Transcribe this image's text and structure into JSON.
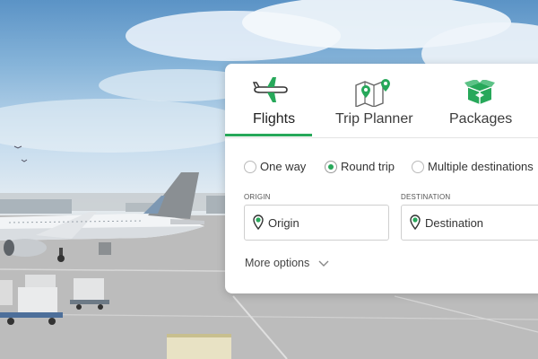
{
  "tabs": [
    {
      "label": "Flights",
      "icon": "airplane-icon",
      "active": true
    },
    {
      "label": "Trip Planner",
      "icon": "map-pins-icon",
      "active": false
    },
    {
      "label": "Packages",
      "icon": "package-box-icon",
      "active": false
    }
  ],
  "trip_type": {
    "options": [
      {
        "label": "One way",
        "selected": false
      },
      {
        "label": "Round trip",
        "selected": true
      },
      {
        "label": "Multiple destinations",
        "selected": false
      }
    ]
  },
  "origin": {
    "caption": "ORIGIN",
    "placeholder": "Origin",
    "value": ""
  },
  "destination": {
    "caption": "DESTINATION",
    "placeholder": "Destination",
    "value": ""
  },
  "more_options": {
    "label": "More options",
    "icon": "chevron-down-icon"
  },
  "colors": {
    "accent": "#27a85a",
    "card_bg": "#ffffff",
    "text": "#333333"
  }
}
